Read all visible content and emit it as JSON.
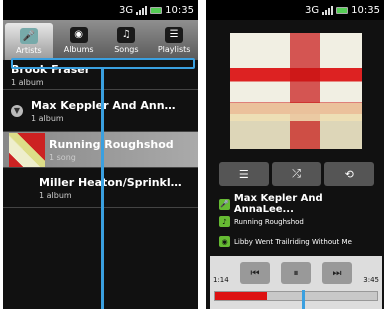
{
  "status": {
    "network": "3G",
    "time": "10:35"
  },
  "left": {
    "tabs": [
      {
        "label": "Artists",
        "icon": "microphone-icon"
      },
      {
        "label": "Albums",
        "icon": "album-icon"
      },
      {
        "label": "Songs",
        "icon": "music-note-icon"
      },
      {
        "label": "Playlists",
        "icon": "playlist-icon"
      }
    ],
    "rows": [
      {
        "title": "Brook Fraser",
        "sub": "1 album"
      },
      {
        "title": "Max Keppler And AnnaLe...",
        "sub": "1 album"
      },
      {
        "title": "Running Roughshod",
        "sub": "1 song"
      },
      {
        "title": "Miller Heaton/Sprinklesky",
        "sub": "1 album"
      }
    ]
  },
  "right": {
    "artist": "Max Kepler And AnnaLee...",
    "song": "Running Roughshod",
    "album": "Libby Went Trailriding Without  Me",
    "elapsed": "1:14",
    "total": "3:45",
    "progress_fraction": 0.32,
    "ctrl_icons": [
      "list-icon",
      "shuffle-icon",
      "repeat-icon"
    ],
    "transport_icons": [
      "previous-icon",
      "pause-icon",
      "next-icon"
    ]
  },
  "colors": {
    "accent_blue": "#3aa0e0",
    "progress_red": "#dd1111"
  }
}
